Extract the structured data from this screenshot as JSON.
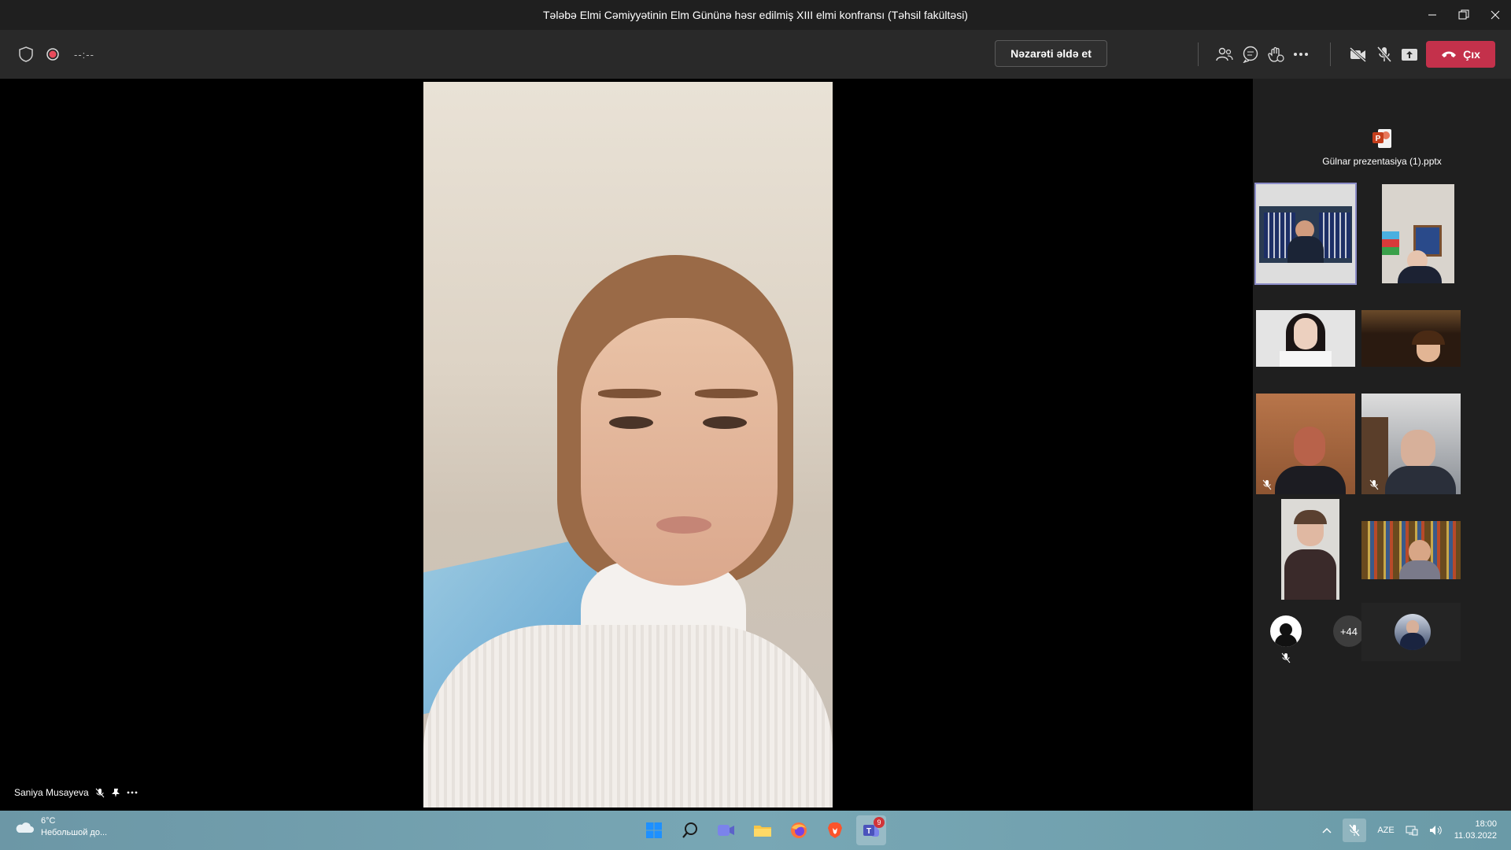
{
  "window": {
    "title": "Tələbə Elmi Cəmiyyətinin Elm Gününə həsr edilmiş XIII elmi konfransı (Təhsil fakültəsi)"
  },
  "toolbar": {
    "timer": "--:--",
    "control_label": "Nəzarəti əldə et",
    "leave_label": "Çıx"
  },
  "main": {
    "speaker_name": "Saniya Musayeva"
  },
  "sidebar": {
    "shared_file": "Gülnar prezentasiya (1).pptx",
    "overflow_count": "+44"
  },
  "taskbar": {
    "weather_temp": "6°C",
    "weather_desc": "Небольшой до...",
    "teams_badge": "9",
    "lang": "AZE",
    "time": "18:00",
    "date": "11.03.2022"
  },
  "colors": {
    "leave": "#c4314b",
    "active_tile": "#8b8cc7",
    "record": "#e84b5b"
  }
}
